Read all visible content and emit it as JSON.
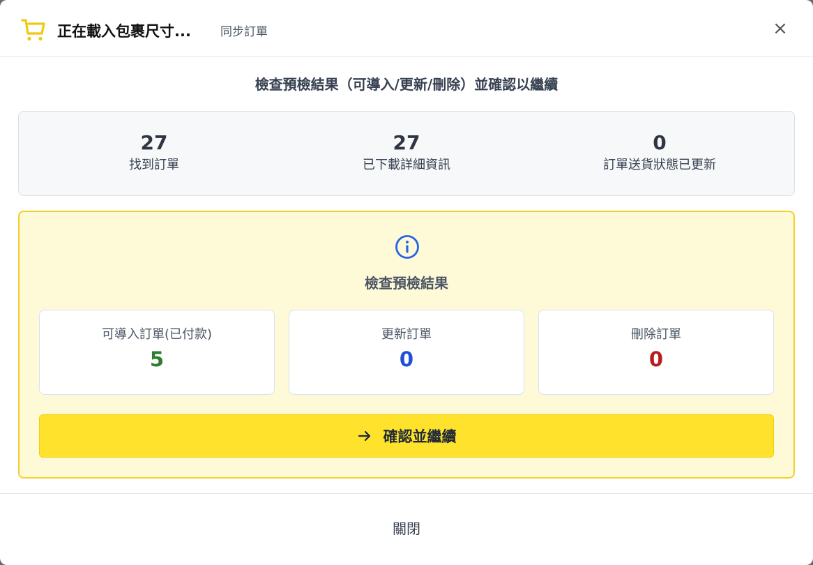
{
  "header": {
    "title": "正在載入包裹尺寸...",
    "subtitle": "同步訂單",
    "close_symbol": "×",
    "icon": "shopping-cart-icon",
    "icon_color": "#f2c80f"
  },
  "section_heading": "檢查預檢結果（可導入/更新/刪除）並確認以繼續",
  "stats": [
    {
      "value": "27",
      "label": "找到訂單"
    },
    {
      "value": "27",
      "label": "已下載詳細資訊"
    },
    {
      "value": "0",
      "label": "訂單送貨狀態已更新"
    }
  ],
  "precheck": {
    "icon": "info-icon",
    "icon_color": "#2563eb",
    "title": "檢查預檢結果",
    "cards": [
      {
        "label": "可導入訂單(已付款)",
        "value": "5",
        "color": "#2e7d32"
      },
      {
        "label": "更新訂單",
        "value": "0",
        "color": "#1e4fd6"
      },
      {
        "label": "刪除訂單",
        "value": "0",
        "color": "#b91c1c"
      }
    ],
    "confirm_label": "確認並繼續",
    "confirm_icon": "arrow-right-icon"
  },
  "footer": {
    "close_label": "關閉"
  }
}
